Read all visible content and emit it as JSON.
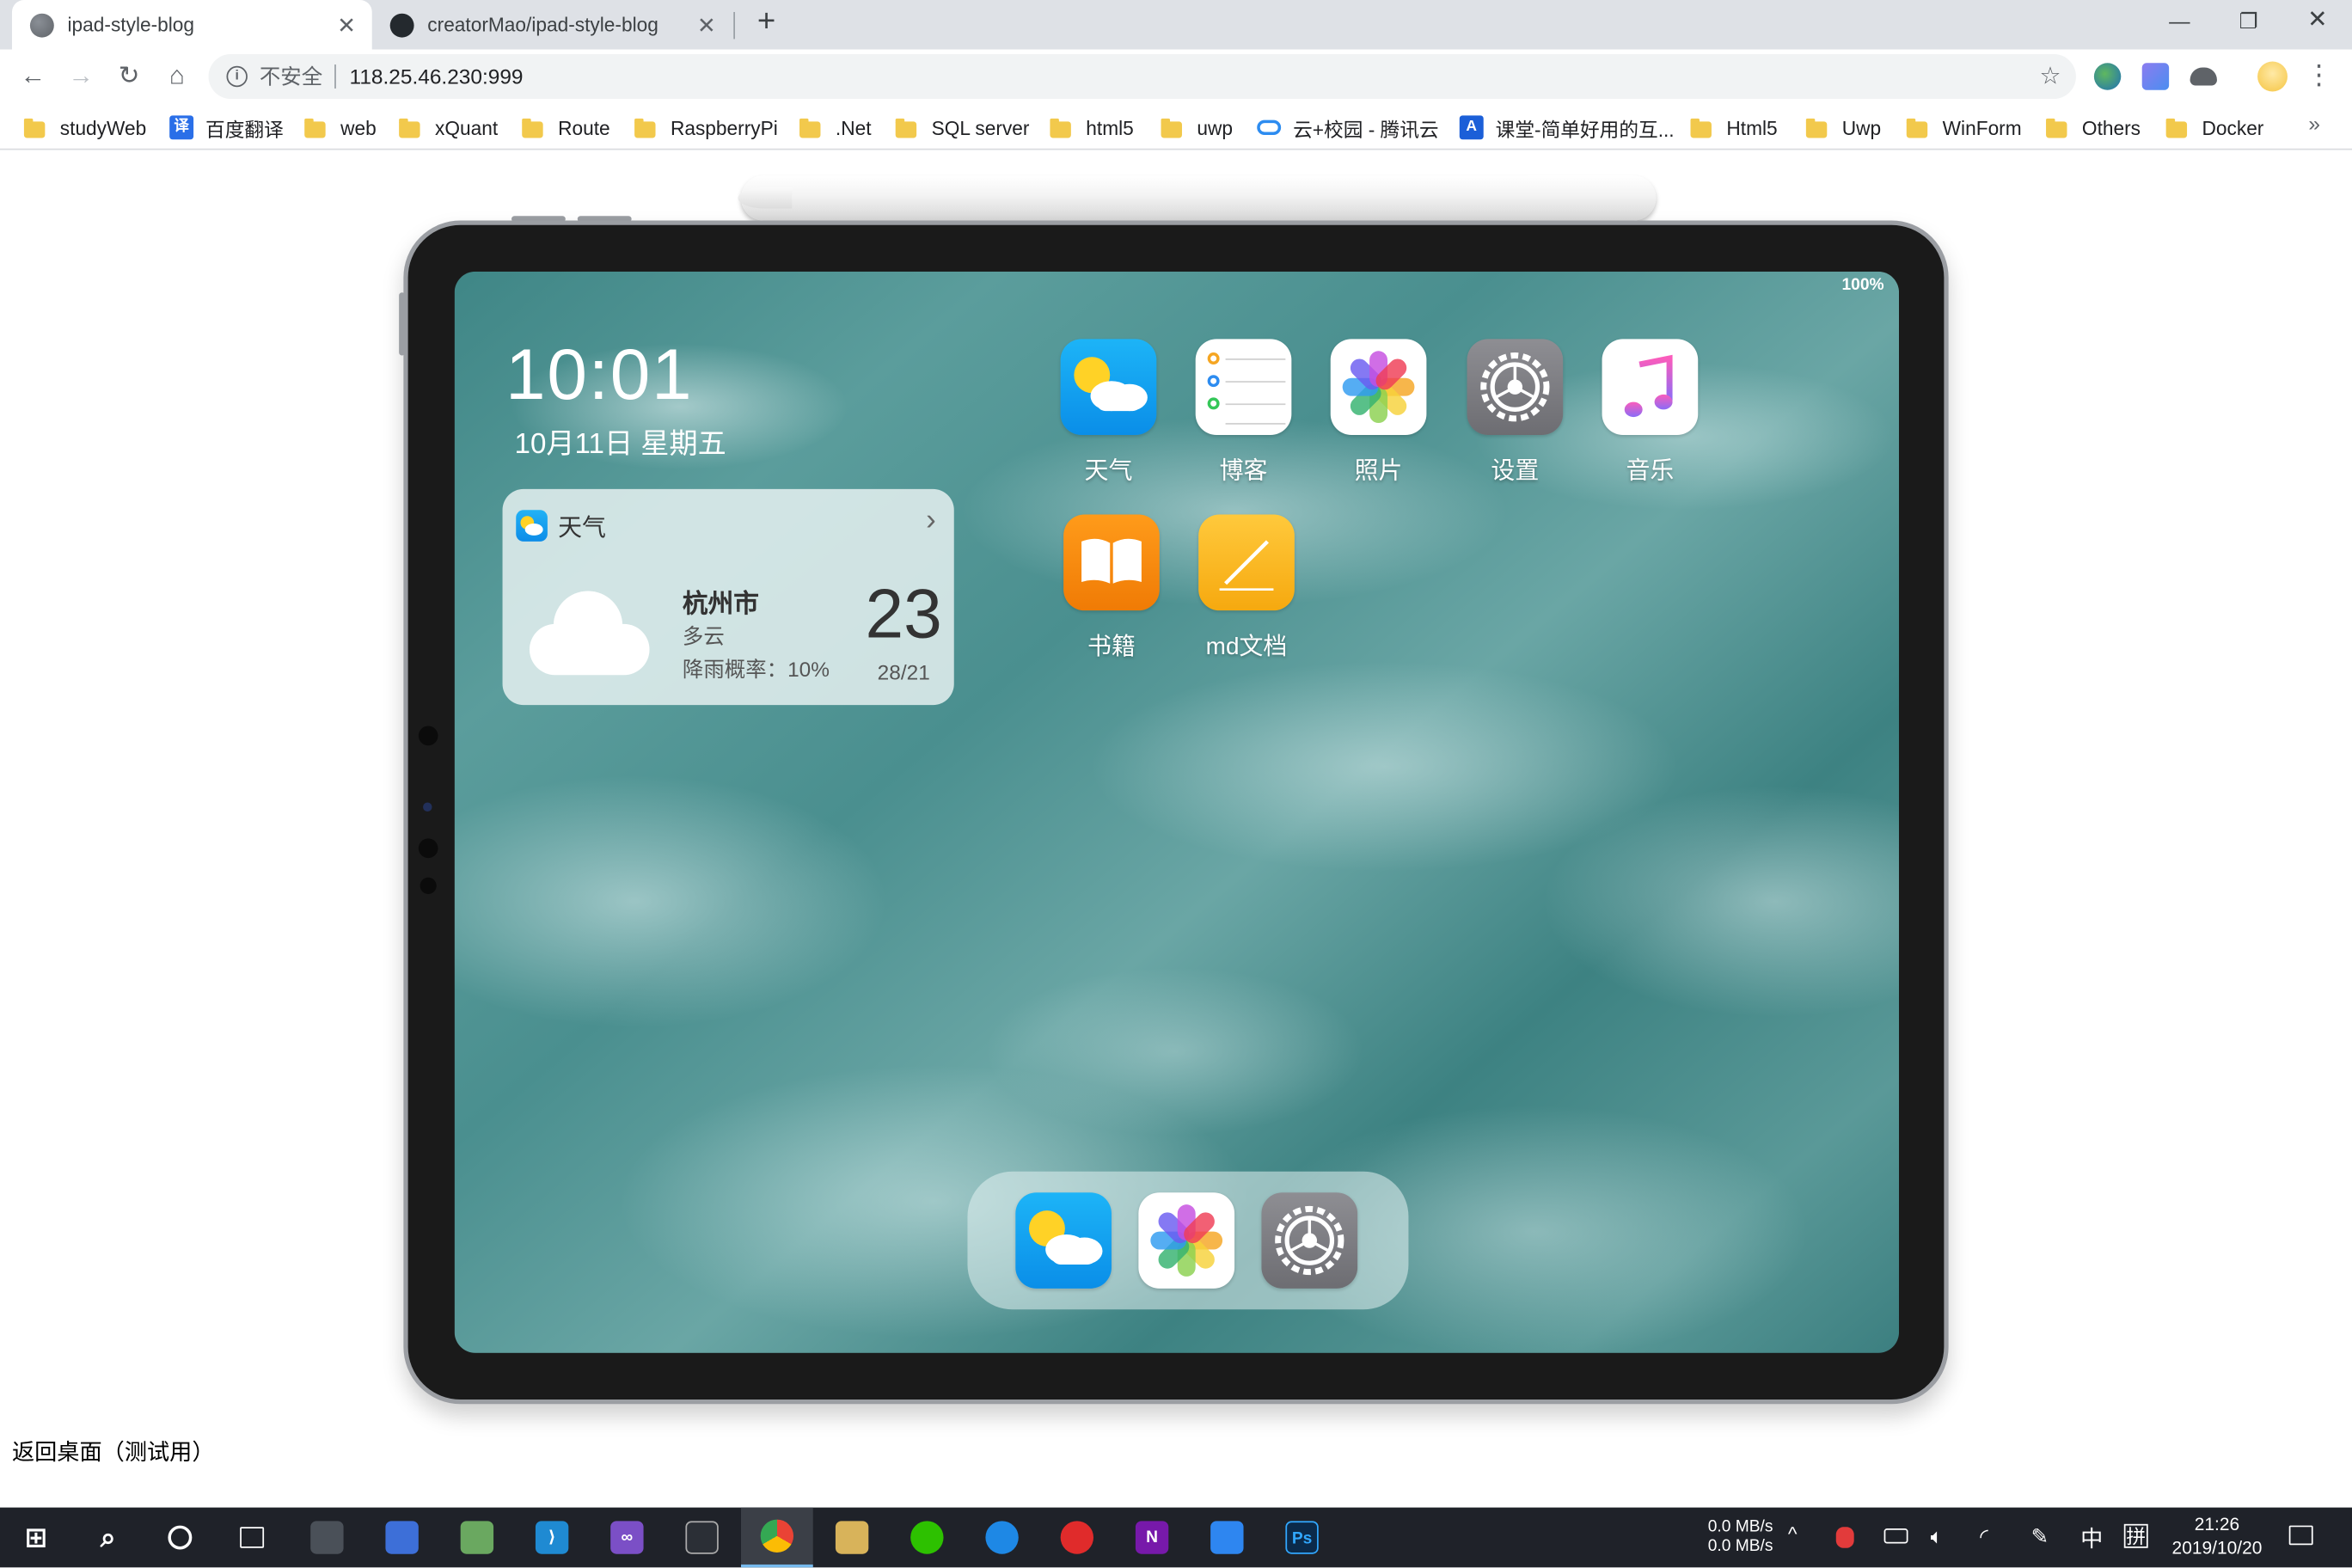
{
  "browser": {
    "tabs": [
      {
        "title": "ipad-style-blog",
        "icon": "globe-icon"
      },
      {
        "title": "creatorMao/ipad-style-blog",
        "icon": "github-icon"
      }
    ],
    "omnibox": {
      "security": "不安全",
      "url": "118.25.46.230:999"
    },
    "window_controls": [
      "minimize",
      "restore",
      "close"
    ]
  },
  "bookmarks": [
    {
      "label": "studyWeb",
      "icon": "folder-icon"
    },
    {
      "label": "百度翻译",
      "icon": "translate-icon",
      "glyph": "译"
    },
    {
      "label": "web",
      "icon": "folder-icon"
    },
    {
      "label": "xQuant",
      "icon": "folder-icon"
    },
    {
      "label": "Route",
      "icon": "folder-icon"
    },
    {
      "label": "RaspberryPi",
      "icon": "folder-icon"
    },
    {
      "label": ".Net",
      "icon": "folder-icon"
    },
    {
      "label": "SQL server",
      "icon": "folder-icon"
    },
    {
      "label": "html5",
      "icon": "folder-icon"
    },
    {
      "label": "uwp",
      "icon": "folder-icon"
    },
    {
      "label": "云+校园 - 腾讯云",
      "icon": "cloud-icon"
    },
    {
      "label": "课堂-简单好用的互...",
      "icon": "classroom-icon"
    },
    {
      "label": "Html5",
      "icon": "folder-icon"
    },
    {
      "label": "Uwp",
      "icon": "folder-icon"
    },
    {
      "label": "WinForm",
      "icon": "folder-icon"
    },
    {
      "label": "Others",
      "icon": "folder-icon"
    },
    {
      "label": "Docker",
      "icon": "folder-icon"
    }
  ],
  "ipad": {
    "battery": "100%",
    "time": "10:01",
    "date": "10月11日 星期五",
    "weather_widget": {
      "title": "天气",
      "city": "杭州市",
      "condition": "多云",
      "rain": "降雨概率：10%",
      "temperature": "23",
      "range": "28/21"
    },
    "apps": [
      {
        "label": "天气",
        "icon": "weather-icon"
      },
      {
        "label": "博客",
        "icon": "blog-list-icon"
      },
      {
        "label": "照片",
        "icon": "photos-icon"
      },
      {
        "label": "设置",
        "icon": "settings-gear-icon"
      },
      {
        "label": "音乐",
        "icon": "music-note-icon"
      },
      {
        "label": "书籍",
        "icon": "books-icon"
      },
      {
        "label": "md文档",
        "icon": "markdown-doc-icon"
      }
    ],
    "dock": [
      "weather-icon",
      "photos-icon",
      "settings-gear-icon"
    ]
  },
  "page": {
    "back_link": "返回桌面（测试用）"
  },
  "taskbar": {
    "net_up": "0.0 MB/s",
    "net_down": "0.0 MB/s",
    "ime": "中",
    "ime2": "拼",
    "time": "21:26",
    "date": "2019/10/20"
  },
  "colors": {
    "accent": "#1a73e8",
    "screen_sea": "#4a8f8f",
    "taskbar": "#1f2229"
  }
}
